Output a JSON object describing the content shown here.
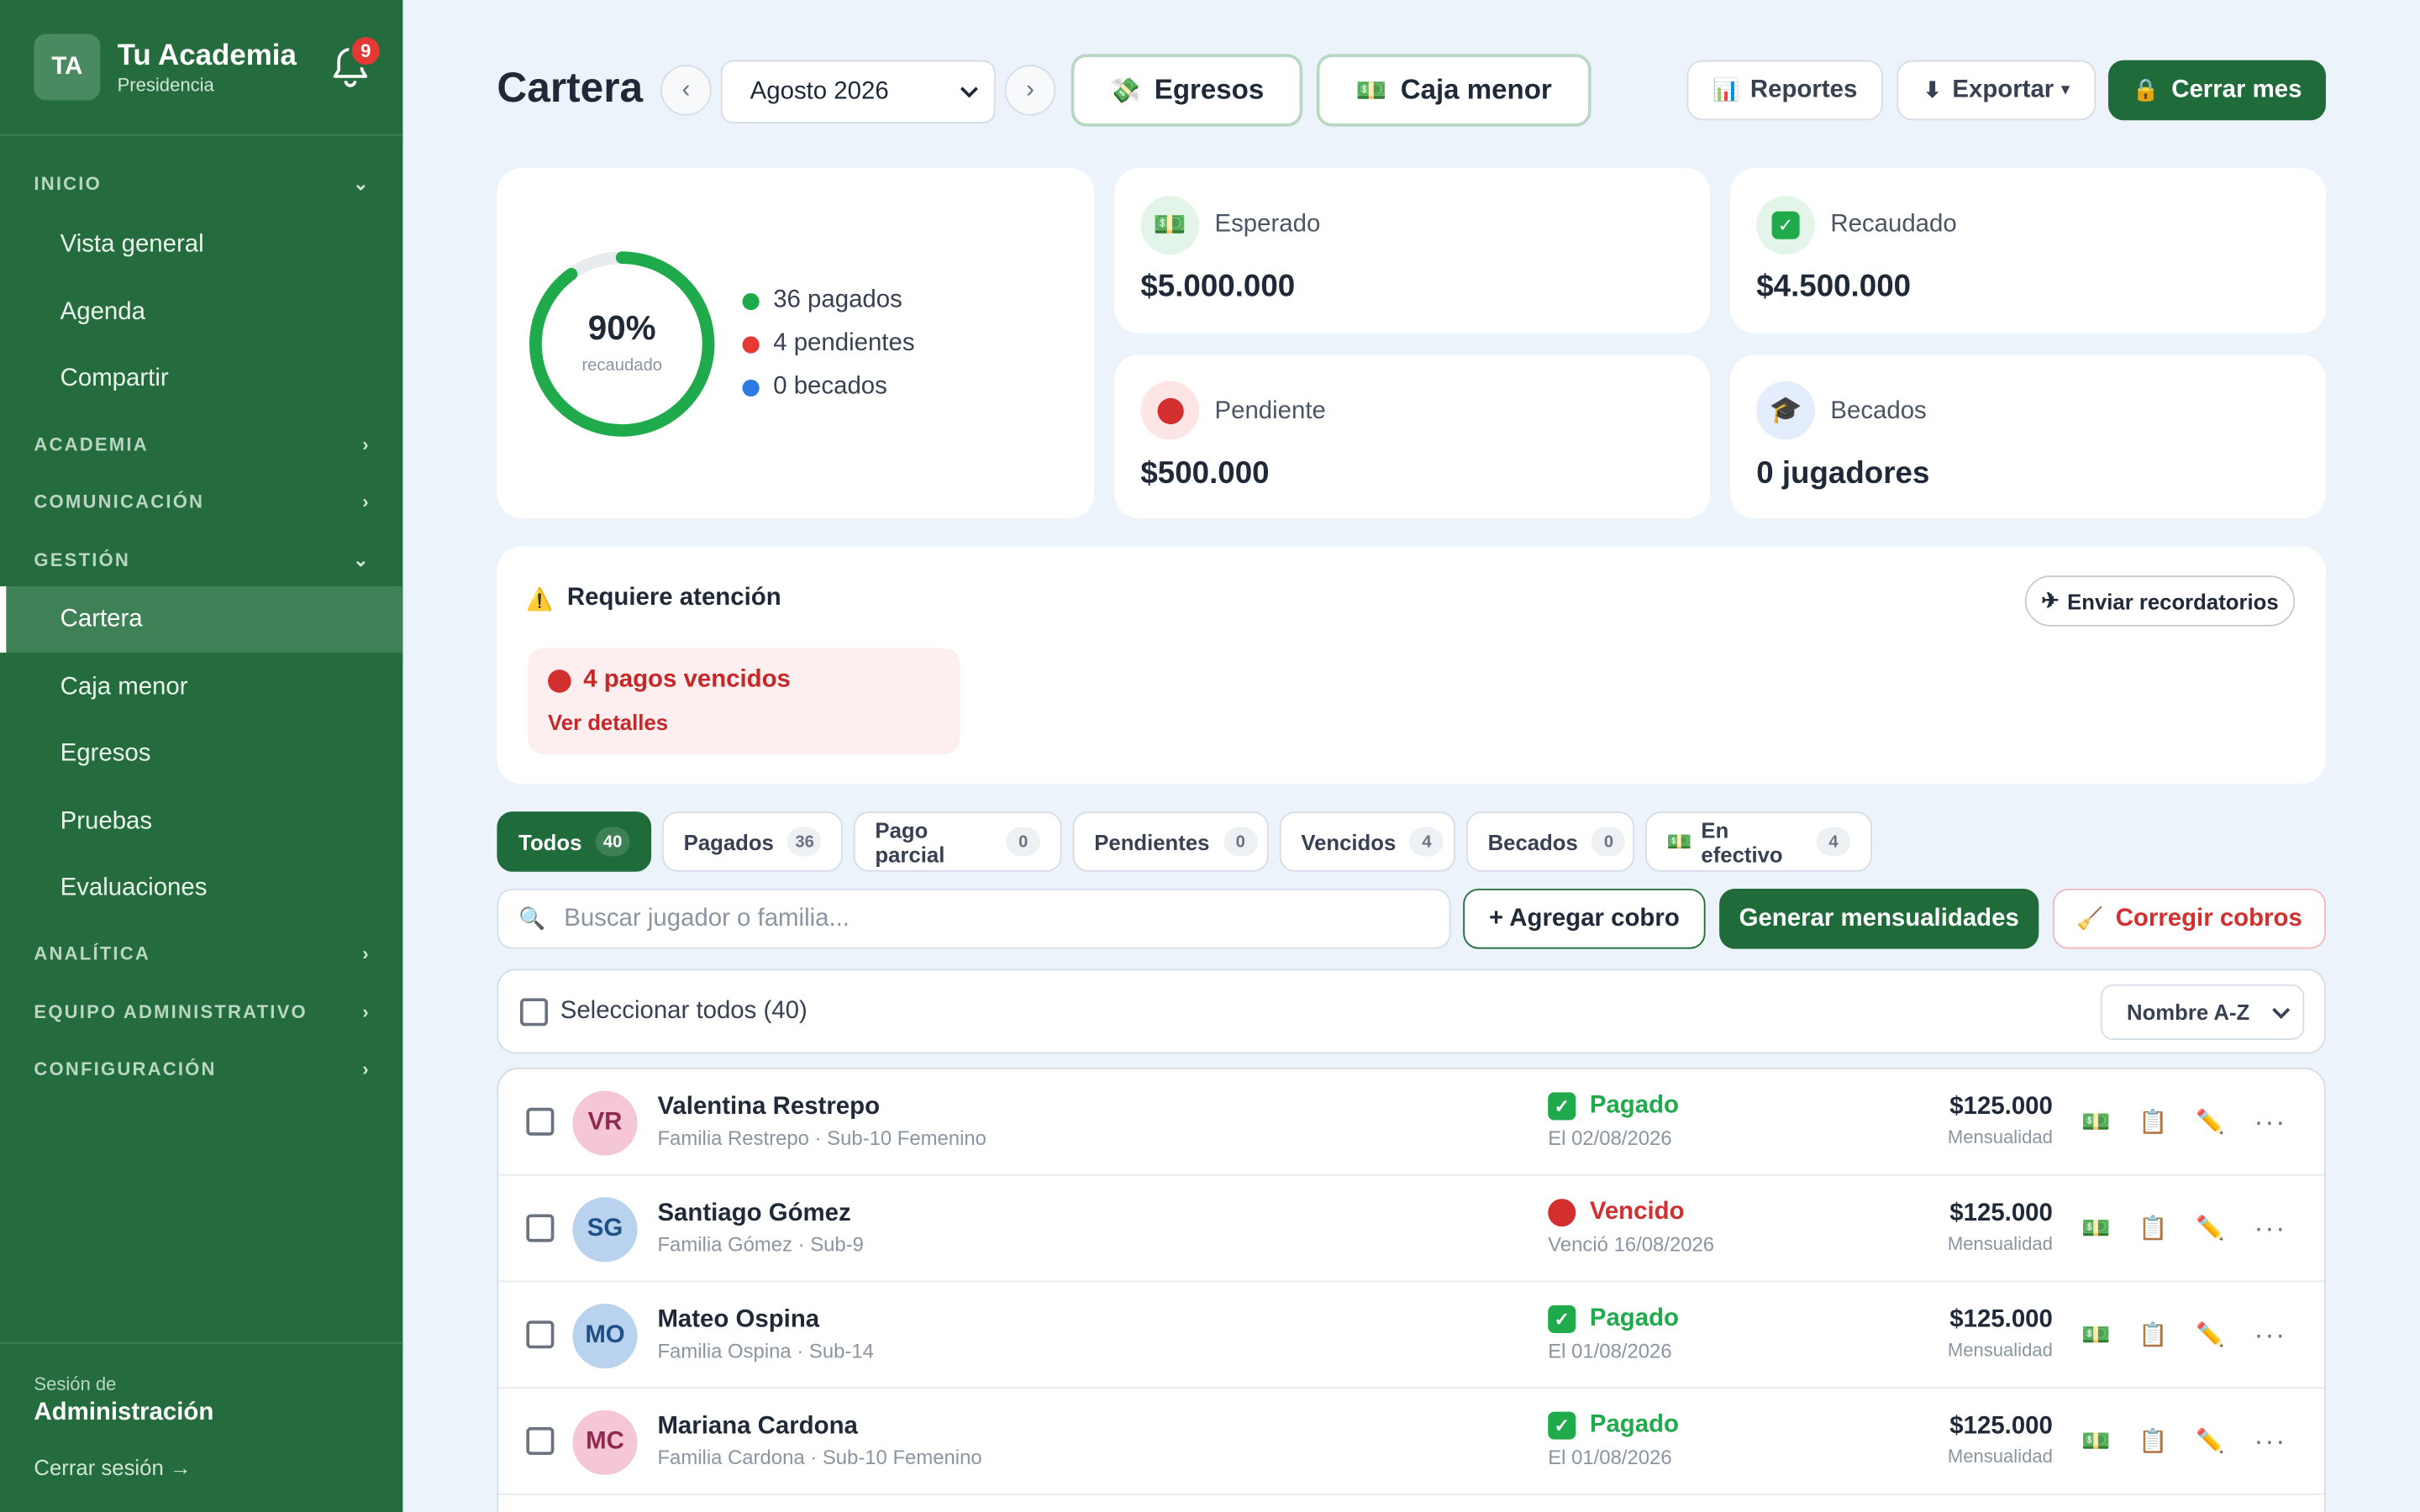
{
  "sidebar": {
    "brand": {
      "initials": "TA",
      "name": "Tu Academia",
      "role": "Presidencia"
    },
    "notifications": {
      "count": "9",
      "icon": "bell-icon"
    },
    "sections": {
      "inicio": {
        "label": "INICIO",
        "items": [
          "Vista general",
          "Agenda",
          "Compartir"
        ]
      },
      "academia": {
        "label": "ACADEMIA"
      },
      "comunicacion": {
        "label": "COMUNICACIÓN"
      },
      "gestion": {
        "label": "GESTIÓN",
        "items": [
          "Cartera",
          "Caja menor",
          "Egresos",
          "Pruebas",
          "Evaluaciones"
        ]
      },
      "analitica": {
        "label": "ANALÍTICA"
      },
      "equipo": {
        "label": "EQUIPO ADMINISTRATIVO"
      },
      "config": {
        "label": "CONFIGURACIÓN"
      }
    },
    "active_item": "Cartera",
    "session": {
      "label": "Sesión de",
      "value": "Administración",
      "logout": "Cerrar sesión →"
    }
  },
  "header": {
    "title": "Cartera",
    "month": "Agosto 2026",
    "prev": "‹",
    "next": "›",
    "egresos": "Egresos",
    "caja_menor": "Caja menor",
    "reportes": "Reportes",
    "exportar": "Exportar",
    "cerrar_mes": "Cerrar mes"
  },
  "summary": {
    "percent_collected": 90,
    "percent_label": "90%",
    "percent_sub": "recaudado",
    "legend": [
      {
        "label": "36 pagados",
        "color": "#1faa4b"
      },
      {
        "label": "4 pendientes",
        "color": "#e53935"
      },
      {
        "label": "0 becados",
        "color": "#2f7be5"
      }
    ],
    "stats": {
      "esperado": {
        "label": "Esperado",
        "value": "$5.000.000",
        "icon": "money-icon"
      },
      "recaudado": {
        "label": "Recaudado",
        "value": "$4.500.000",
        "icon": "check-icon"
      },
      "pendiente": {
        "label": "Pendiente",
        "value": "$500.000",
        "icon": "red-circle-icon"
      },
      "becados": {
        "label": "Becados",
        "value": "0 jugadores",
        "icon": "graduation-cap-icon"
      }
    }
  },
  "attention": {
    "title": "Requiere atención",
    "remind_button": "Enviar recordatorios",
    "alert_title": "4 pagos vencidos",
    "alert_link": "Ver detalles"
  },
  "filters": {
    "tabs": [
      {
        "label": "Todos",
        "count": "40"
      },
      {
        "label": "Pagados",
        "count": "36"
      },
      {
        "label": "Pago parcial",
        "count": "0"
      },
      {
        "label": "Pendientes",
        "count": "0"
      },
      {
        "label": "Vencidos",
        "count": "4"
      },
      {
        "label": "Becados",
        "count": "0"
      },
      {
        "label": "En efectivo",
        "count": "4"
      }
    ],
    "search_placeholder": "Buscar jugador o familia...",
    "add_charge": "+ Agregar cobro",
    "generate": "Generar mensualidades",
    "correct": "Corregir cobros",
    "select_all": "Seleccionar todos (40)",
    "sort": "Nombre A-Z"
  },
  "rows": [
    {
      "initials": "VR",
      "name": "Valentina Restrepo",
      "sub": "Familia Restrepo · Sub-10 Femenino",
      "status": "Pagado",
      "date": "El 02/08/2026",
      "amount": "$125.000",
      "type": "Mensualidad",
      "avatar_bg": "#f5c6d6",
      "avatar_fg": "#8e2a4f"
    },
    {
      "initials": "SG",
      "name": "Santiago Gómez",
      "sub": "Familia Gómez · Sub-9",
      "status": "Vencido",
      "date": "Venció 16/08/2026",
      "amount": "$125.000",
      "type": "Mensualidad",
      "avatar_bg": "#b9d3ef",
      "avatar_fg": "#1e4f86"
    },
    {
      "initials": "MO",
      "name": "Mateo Ospina",
      "sub": "Familia Ospina · Sub-14",
      "status": "Pagado",
      "date": "El 01/08/2026",
      "amount": "$125.000",
      "type": "Mensualidad",
      "avatar_bg": "#b9d3ef",
      "avatar_fg": "#1e4f86"
    },
    {
      "initials": "MC",
      "name": "Mariana Cardona",
      "sub": "Familia Cardona · Sub-10 Femenino",
      "status": "Pagado",
      "date": "El 01/08/2026",
      "amount": "$125.000",
      "type": "Mensualidad",
      "avatar_bg": "#f5c6d6",
      "avatar_fg": "#8e2a4f"
    }
  ],
  "colors": {
    "brand": "#246b3d",
    "accent": "#1f6b3a",
    "paid": "#1faa4b",
    "overdue": "#d32f2f"
  }
}
